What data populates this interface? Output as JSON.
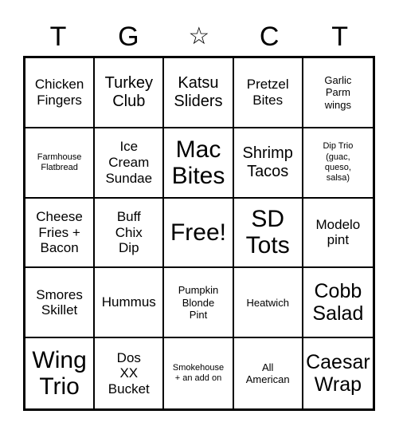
{
  "card": {
    "type": "bingo-card",
    "columns": 5,
    "rows": 5,
    "header": [
      {
        "label": "T",
        "icon": null
      },
      {
        "label": "G",
        "icon": null
      },
      {
        "label": "☆",
        "icon": "star-outline-icon"
      },
      {
        "label": "C",
        "icon": null
      },
      {
        "label": "T",
        "icon": null
      }
    ],
    "colors": {
      "background": "#ffffff",
      "text": "#000000",
      "grid_line": "#000000"
    },
    "cells": [
      {
        "text": "Chicken\nFingers",
        "size": "md",
        "free": false
      },
      {
        "text": "Turkey\nClub",
        "size": "lg",
        "free": false
      },
      {
        "text": "Katsu\nSliders",
        "size": "lg",
        "free": false
      },
      {
        "text": "Pretzel\nBites",
        "size": "md",
        "free": false
      },
      {
        "text": "Garlic\nParm\nwings",
        "size": "sm",
        "free": false
      },
      {
        "text": "Farmhouse\nFlatbread",
        "size": "xs",
        "free": false
      },
      {
        "text": "Ice\nCream\nSundae",
        "size": "md",
        "free": false
      },
      {
        "text": "Mac\nBites",
        "size": "xxl",
        "free": false
      },
      {
        "text": "Shrimp\nTacos",
        "size": "lg",
        "free": false
      },
      {
        "text": "Dip Trio\n(guac,\nqueso,\nsalsa)",
        "size": "xs",
        "free": false
      },
      {
        "text": "Cheese\nFries +\nBacon",
        "size": "md",
        "free": false
      },
      {
        "text": "Buff\nChix\nDip",
        "size": "md",
        "free": false
      },
      {
        "text": "Free!",
        "size": "xxl",
        "free": true
      },
      {
        "text": "SD\nTots",
        "size": "xxl",
        "free": false
      },
      {
        "text": "Modelo\npint",
        "size": "md",
        "free": false
      },
      {
        "text": "Smores\nSkillet",
        "size": "md",
        "free": false
      },
      {
        "text": "Hummus",
        "size": "md",
        "free": false
      },
      {
        "text": "Pumpkin\nBlonde\nPint",
        "size": "sm",
        "free": false
      },
      {
        "text": "Heatwich",
        "size": "sm",
        "free": false
      },
      {
        "text": "Cobb\nSalad",
        "size": "xl",
        "free": false
      },
      {
        "text": "Wing\nTrio",
        "size": "xxl",
        "free": false
      },
      {
        "text": "Dos\nXX\nBucket",
        "size": "md",
        "free": false
      },
      {
        "text": "Smokehouse\n+ an add on",
        "size": "xs",
        "free": false
      },
      {
        "text": "All\nAmerican",
        "size": "sm",
        "free": false
      },
      {
        "text": "Caesar\nWrap",
        "size": "xl",
        "free": false
      }
    ]
  }
}
